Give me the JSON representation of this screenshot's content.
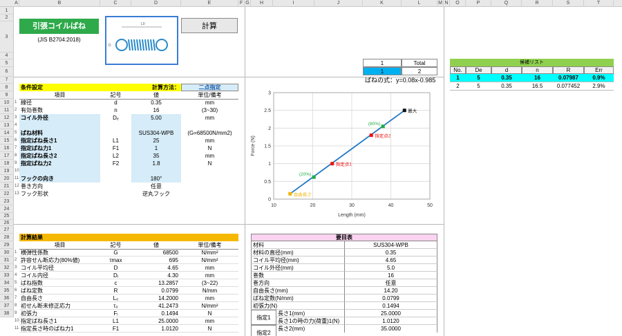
{
  "columns": [
    "A",
    "B",
    "C",
    "D",
    "E",
    "F",
    "G",
    "H",
    "I",
    "J",
    "K",
    "L",
    "M",
    "N",
    "O",
    "P",
    "Q",
    "R",
    "S",
    "T"
  ],
  "rows": [
    "1",
    "2",
    "3",
    "4",
    "5",
    "6",
    "7",
    "8",
    "9",
    "10",
    "11",
    "12",
    "13",
    "14",
    "15",
    "16",
    "17",
    "18",
    "19",
    "20",
    "21",
    "22",
    "23",
    "24",
    "25",
    "26",
    "27",
    "28",
    "29",
    "30",
    "31",
    "32",
    "33",
    "34",
    "35",
    "36",
    "37",
    "38"
  ],
  "title": {
    "main": "引張コイルばね",
    "sub": "(JIS B2704:2018)",
    "calc_button": "計算",
    "dim_L": "L0",
    "dim_D": "D"
  },
  "selector": {
    "k4": "1",
    "l4": "Total",
    "k5": "1",
    "l5": "2"
  },
  "formula": "ばねの式：y=0.08x-0.985",
  "conditions": {
    "header": "条件設定",
    "method_label": "計算方法：",
    "method_value": "二点指定",
    "col_item": "項目",
    "col_symbol": "記号",
    "col_value": "値",
    "col_unit": "単位/備考",
    "rows": [
      {
        "n": "1",
        "item": "線径",
        "sym": "d",
        "val": "0.35",
        "unit": "mm",
        "bold": false
      },
      {
        "n": "2",
        "item": "有効巻数",
        "sym": "n",
        "val": "16",
        "unit": "(3~30)",
        "bold": false
      },
      {
        "n": "3",
        "item": "コイル外径",
        "sym": "Dₑ",
        "val": "5.00",
        "unit": "mm",
        "bold": true
      },
      {
        "n": "4",
        "item": "",
        "sym": "",
        "val": "",
        "unit": "",
        "bold": false
      },
      {
        "n": "5",
        "item": "ばね材料",
        "sym": "",
        "val": "SUS304-WPB",
        "unit": "(G=68500N/mm2)",
        "bold": true
      },
      {
        "n": "6",
        "item": "指定ばね長さ1",
        "sym": "L1",
        "val": "25",
        "unit": "mm",
        "bold": true
      },
      {
        "n": "7",
        "item": "指定ばね力1",
        "sym": "F1",
        "val": "1",
        "unit": "N",
        "bold": true
      },
      {
        "n": "8",
        "item": "指定ばね長さ2",
        "sym": "L2",
        "val": "35",
        "unit": "mm",
        "bold": true
      },
      {
        "n": "9",
        "item": "指定ばね力2",
        "sym": "F2",
        "val": "1.8",
        "unit": "N",
        "bold": true
      },
      {
        "n": "10",
        "item": "",
        "sym": "",
        "val": "",
        "unit": "",
        "bold": false
      },
      {
        "n": "11",
        "item": "フックの向き",
        "sym": "",
        "val": "180°",
        "unit": "",
        "bold": true
      },
      {
        "n": "12",
        "item": "巻き方向",
        "sym": "",
        "val": "任意",
        "unit": "",
        "bold": false
      },
      {
        "n": "13",
        "item": "フック形状",
        "sym": "",
        "val": "逆丸フック",
        "unit": "",
        "bold": false
      }
    ]
  },
  "results": {
    "header": "計算結果",
    "col_item": "項目",
    "col_symbol": "記号",
    "col_value": "値",
    "col_unit": "単位/備考",
    "rows": [
      {
        "n": "1",
        "item": "横弾性係数",
        "sym": "G",
        "val": "68500",
        "unit": "N/mm²"
      },
      {
        "n": "2",
        "item": "許容せん断応力(80%値)",
        "sym": "τmax",
        "val": "695",
        "unit": "N/mm²"
      },
      {
        "n": "3",
        "item": "コイル平均径",
        "sym": "D",
        "val": "4.65",
        "unit": "mm"
      },
      {
        "n": "4",
        "item": "コイル内径",
        "sym": "Dᵢ",
        "val": "4.30",
        "unit": "mm"
      },
      {
        "n": "5",
        "item": "ばね指数",
        "sym": "c",
        "val": "13.2857",
        "unit": "(3~22)"
      },
      {
        "n": "6",
        "item": "ばね定数",
        "sym": "R",
        "val": "0.0799",
        "unit": "N/mm"
      },
      {
        "n": "7",
        "item": "自由長さ",
        "sym": "L₀",
        "val": "14.2000",
        "unit": "mm"
      },
      {
        "n": "8",
        "item": "初せん断未修正応力",
        "sym": "τ₀",
        "val": "41.2473",
        "unit": "N/mm²"
      },
      {
        "n": "9",
        "item": "初張力",
        "sym": "Fᵢ",
        "val": "0.1494",
        "unit": "N"
      },
      {
        "n": "10",
        "item": "指定ばね長さ1",
        "sym": "L1",
        "val": "25.0000",
        "unit": "mm"
      },
      {
        "n": "11",
        "item": "指定長さ時のばね力1",
        "sym": "F1",
        "val": "1.0120",
        "unit": "N"
      }
    ]
  },
  "summary": {
    "header": "要目表",
    "rows": [
      {
        "k": "材料",
        "v": "SUS304-WPB"
      },
      {
        "k": "材料の直径(mm)",
        "v": "0.35"
      },
      {
        "k": "コイル平均径(mm)",
        "v": "4.65"
      },
      {
        "k": "コイル外径(mm)",
        "v": "5.0"
      },
      {
        "k": "巻数",
        "v": "16"
      },
      {
        "k": "巻方向",
        "v": "任意"
      },
      {
        "k": "自由長さ(mm)",
        "v": "14.20"
      },
      {
        "k": "ばね定数(N/mm)",
        "v": "0.0799"
      },
      {
        "k": "初張力(N)",
        "v": "0.1494"
      }
    ],
    "spec1_label": "指定1",
    "spec1_rows": [
      {
        "k": "長さ1(mm)",
        "v": "25.0000"
      },
      {
        "k": "長さ1の時の力(荷重)1(N)",
        "v": "1.0120"
      }
    ],
    "spec2_label": "指定2",
    "spec2_rows": [
      {
        "k": "長さ2(mm)",
        "v": "35.0000"
      }
    ]
  },
  "candidates": {
    "header": "候補リスト",
    "cols": [
      "No.",
      "De",
      "d",
      "n",
      "R",
      "Err"
    ],
    "rows": [
      [
        "1",
        "5",
        "0.35",
        "16",
        "0.07987",
        "0.9%"
      ],
      [
        "2",
        "5",
        "0.35",
        "16.5",
        "0.077452",
        "2.9%"
      ]
    ]
  },
  "chart_data": {
    "type": "scatter",
    "xlabel": "Length (mm)",
    "ylabel": "Force (N)",
    "xlim": [
      10,
      50
    ],
    "ylim": [
      0,
      3
    ],
    "xticks": [
      "10",
      "20",
      "30",
      "40",
      "50"
    ],
    "yticks": [
      "0",
      "0.5",
      "1",
      "1.5",
      "2",
      "2.5",
      "3"
    ],
    "line": {
      "x": [
        14.2,
        43.5
      ],
      "y": [
        0.15,
        2.5
      ],
      "color": "#1f77c4"
    },
    "points": [
      {
        "x": 14.2,
        "y": 0.15,
        "label": "自由長さ",
        "color": "#f0b400"
      },
      {
        "x": 20.3,
        "y": 0.62,
        "label": "(20%)",
        "color": "#22aa44"
      },
      {
        "x": 25,
        "y": 1.0,
        "label": "指定点1",
        "color": "#ee1111"
      },
      {
        "x": 35,
        "y": 1.8,
        "label": "指定点2",
        "color": "#ee1111"
      },
      {
        "x": 38.0,
        "y": 2.05,
        "label": "(80%)",
        "color": "#22aa44"
      },
      {
        "x": 43.5,
        "y": 2.5,
        "label": "最大",
        "color": "#111111"
      }
    ]
  }
}
